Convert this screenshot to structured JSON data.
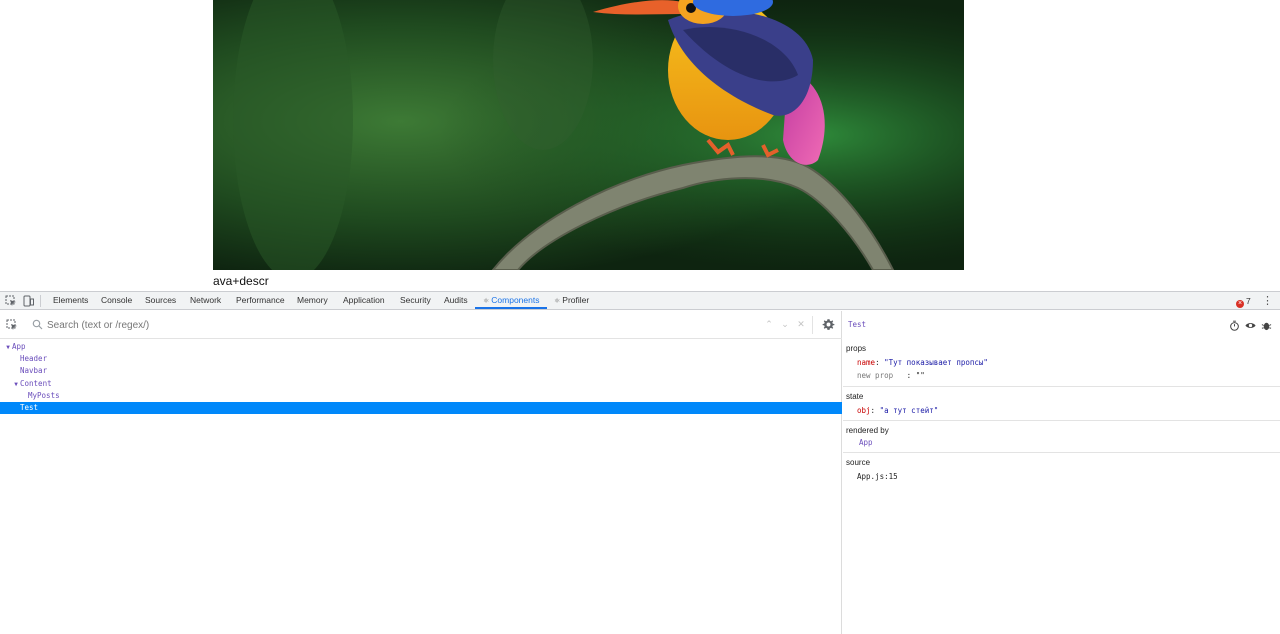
{
  "page": {
    "caption": "ava+descr"
  },
  "devtools": {
    "tabs": [
      {
        "label": "Elements"
      },
      {
        "label": "Console"
      },
      {
        "label": "Sources"
      },
      {
        "label": "Network"
      },
      {
        "label": "Performance"
      },
      {
        "label": "Memory"
      },
      {
        "label": "Application"
      },
      {
        "label": "Security"
      },
      {
        "label": "Audits"
      },
      {
        "label": "Components",
        "active": true,
        "icon": "react-icon"
      },
      {
        "label": "Profiler",
        "icon": "react-icon"
      }
    ],
    "error_count": "7",
    "search": {
      "placeholder": "Search (text or /regex/)"
    },
    "tree": [
      {
        "label": "App",
        "expanded": true
      },
      {
        "label": "Header"
      },
      {
        "label": "Navbar"
      },
      {
        "label": "Content",
        "expanded": true
      },
      {
        "label": "MyPosts"
      },
      {
        "label": "Test",
        "selected": true
      }
    ],
    "inspector": {
      "title": "Test",
      "props": {
        "heading": "props",
        "name_key": "name",
        "name_value": "\"Тут показывает пропсы\"",
        "new_prop_key": "new prop",
        "new_prop_value": ": \"\""
      },
      "state": {
        "heading": "state",
        "obj_key": "obj",
        "obj_value": "\"а тут стейт\""
      },
      "rendered_by": {
        "heading": "rendered by",
        "value": "App"
      },
      "source": {
        "heading": "source",
        "value": "App.js:15"
      }
    }
  },
  "colors": {
    "accent": "#1a73e8",
    "selection": "#0088fa",
    "component": "#6a4dbb",
    "prop_key": "#c80000",
    "string": "#1a1aa6",
    "error": "#d93025"
  },
  "icons": [
    "kingfisher-photo",
    "select-element-icon",
    "device-toggle-icon",
    "react-icon",
    "search-icon",
    "chevron-up-icon",
    "chevron-down-icon",
    "clear-icon",
    "gear-icon",
    "timer-icon",
    "eye-icon",
    "bug-icon",
    "kebab-icon",
    "error-icon"
  ]
}
